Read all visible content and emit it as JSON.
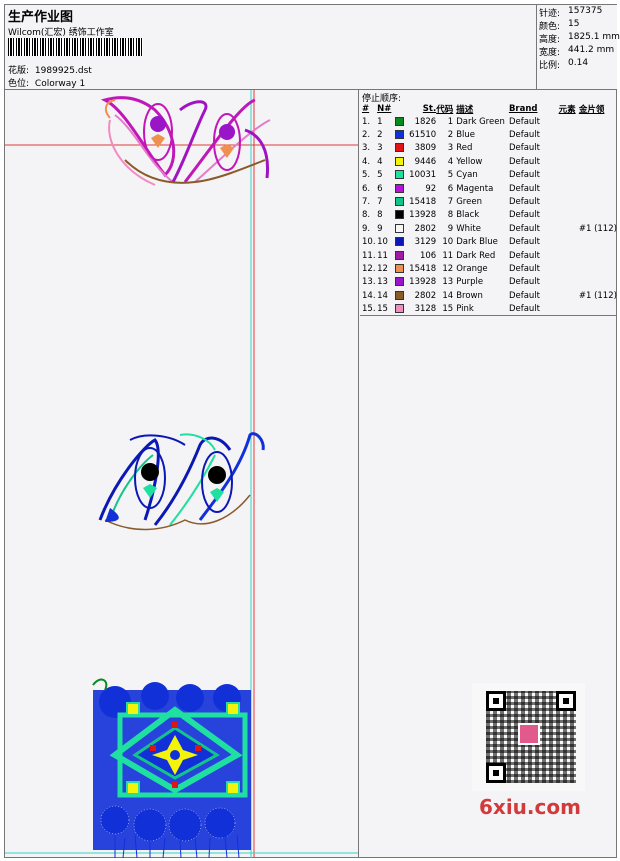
{
  "header": {
    "title": "生产作业图",
    "company": "Wilcom(汇宏) 绣饰工作室",
    "file_label": "花版:",
    "file_name": "1989925.dst",
    "colorway_label": "色位:",
    "colorway_name": "Colorway 1"
  },
  "stats": [
    {
      "label": "针迹:",
      "value": "157375"
    },
    {
      "label": "颜色:",
      "value": "15"
    },
    {
      "label": "高度:",
      "value": "1825.1 mm"
    },
    {
      "label": "宽度:",
      "value": "441.2 mm"
    },
    {
      "label": "比例:",
      "value": "0.14"
    }
  ],
  "sequence": {
    "title": "停止顺序:",
    "columns": [
      "#",
      "N#",
      "",
      "St.",
      "代码",
      "描述",
      "Brand",
      "元素",
      "金片领"
    ],
    "rows": [
      {
        "n": "1.",
        "no": "1",
        "color": "#0a8a1e",
        "st": "1826",
        "code": "1",
        "desc": "Dark Green",
        "brand": "Default",
        "el": "",
        "seq": ""
      },
      {
        "n": "2.",
        "no": "2",
        "color": "#1230d8",
        "st": "61510",
        "code": "2",
        "desc": "Blue",
        "brand": "Default",
        "el": "",
        "seq": ""
      },
      {
        "n": "3.",
        "no": "3",
        "color": "#e01414",
        "st": "3809",
        "code": "3",
        "desc": "Red",
        "brand": "Default",
        "el": "",
        "seq": ""
      },
      {
        "n": "4.",
        "no": "4",
        "color": "#f4f40a",
        "st": "9446",
        "code": "4",
        "desc": "Yellow",
        "brand": "Default",
        "el": "",
        "seq": ""
      },
      {
        "n": "5.",
        "no": "5",
        "color": "#1fe0a0",
        "st": "10031",
        "code": "5",
        "desc": "Cyan",
        "brand": "Default",
        "el": "",
        "seq": ""
      },
      {
        "n": "6.",
        "no": "6",
        "color": "#b414d8",
        "st": "92",
        "code": "6",
        "desc": "Magenta",
        "brand": "Default",
        "el": "",
        "seq": ""
      },
      {
        "n": "7.",
        "no": "7",
        "color": "#12c48a",
        "st": "15418",
        "code": "7",
        "desc": "Green",
        "brand": "Default",
        "el": "",
        "seq": ""
      },
      {
        "n": "8.",
        "no": "8",
        "color": "#000000",
        "st": "13928",
        "code": "8",
        "desc": "Black",
        "brand": "Default",
        "el": "",
        "seq": ""
      },
      {
        "n": "9.",
        "no": "9",
        "color": "#f6f6f6",
        "st": "2802",
        "code": "9",
        "desc": "White",
        "brand": "Default",
        "el": "",
        "seq": "#1 (112)"
      },
      {
        "n": "10.",
        "no": "10",
        "color": "#0c18b4",
        "st": "3129",
        "code": "10",
        "desc": "Dark Blue",
        "brand": "Default",
        "el": "",
        "seq": ""
      },
      {
        "n": "11.",
        "no": "11",
        "color": "#a01aa8",
        "st": "106",
        "code": "11",
        "desc": "Dark Red",
        "brand": "Default",
        "el": "",
        "seq": ""
      },
      {
        "n": "12.",
        "no": "12",
        "color": "#f09050",
        "st": "15418",
        "code": "12",
        "desc": "Orange",
        "brand": "Default",
        "el": "",
        "seq": ""
      },
      {
        "n": "13.",
        "no": "13",
        "color": "#9a14c8",
        "st": "13928",
        "code": "13",
        "desc": "Purple",
        "brand": "Default",
        "el": "",
        "seq": ""
      },
      {
        "n": "14.",
        "no": "14",
        "color": "#8a5a2a",
        "st": "2802",
        "code": "14",
        "desc": "Brown",
        "brand": "Default",
        "el": "",
        "seq": "#1 (112)"
      },
      {
        "n": "15.",
        "no": "15",
        "color": "#f08cc0",
        "st": "3128",
        "code": "15",
        "desc": "Pink",
        "brand": "Default",
        "el": "",
        "seq": ""
      }
    ]
  },
  "watermark": "6xiu.com"
}
